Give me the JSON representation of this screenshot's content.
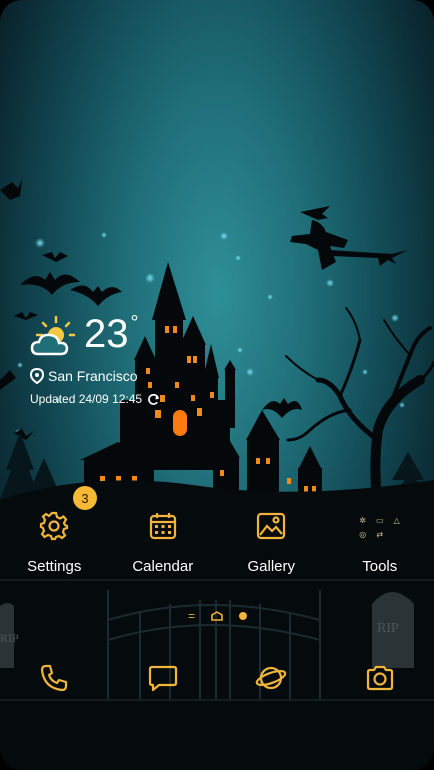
{
  "weather": {
    "temperature": "23",
    "degree_symbol": "°",
    "city": "San Francisco",
    "updated": "Updated 24/09 12:45",
    "condition_icon": "partly-cloudy-sun"
  },
  "apps": [
    {
      "label": "Settings",
      "icon": "gear-icon",
      "badge": "3"
    },
    {
      "label": "Calendar",
      "icon": "calendar-icon"
    },
    {
      "label": "Gallery",
      "icon": "gallery-icon"
    },
    {
      "label": "Tools",
      "icon": "tools-folder-icon"
    }
  ],
  "dock": [
    {
      "icon": "phone-icon"
    },
    {
      "icon": "message-icon"
    },
    {
      "icon": "browser-planet-icon"
    },
    {
      "icon": "camera-icon"
    }
  ],
  "pager": {
    "current": 2,
    "total": 3
  },
  "wallpaper": {
    "tombstone_text": "RIP",
    "tombstone_text_left": "RIP"
  },
  "colors": {
    "accent": "#f0b53a",
    "badge": "#f5b935",
    "sky": "#1f6e78",
    "silhouette": "#050a0c",
    "window_glow": "#f08a1e"
  }
}
